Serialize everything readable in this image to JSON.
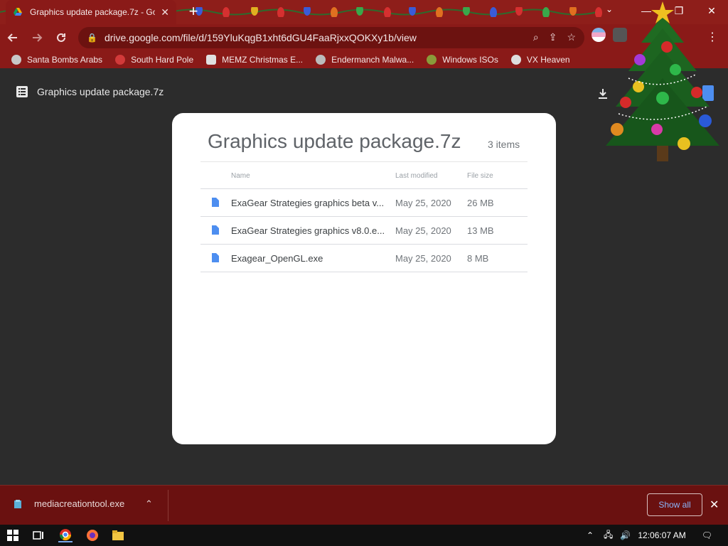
{
  "browser": {
    "tab_title": "Graphics update package.7z - Go",
    "tab_close": "✕",
    "new_tab": "+",
    "url": "drive.google.com/file/d/159YluKqgB1xht6dGU4FaaRjxxQOKXy1b/view",
    "window_controls": {
      "minimize": "—",
      "restore": "❐",
      "close": "✕"
    }
  },
  "bookmarks": [
    {
      "label": "Santa Bombs Arabs",
      "color": "#c8c8c8"
    },
    {
      "label": "South Hard Pole",
      "color": "#d23a3a"
    },
    {
      "label": "MEMZ Christmas E...",
      "color": "#e0e0e0"
    },
    {
      "label": "Endermanch Malwa...",
      "color": "#bbbbbb"
    },
    {
      "label": "Windows ISOs",
      "color": "#8a9b3a"
    },
    {
      "label": "VX Heaven",
      "color": "#dddddd"
    }
  ],
  "viewer": {
    "header_title": "Graphics update package.7z",
    "archive_title": "Graphics update package.7z",
    "item_count": "3 items",
    "columns": {
      "name": "Name",
      "modified": "Last modified",
      "size": "File size"
    },
    "files": [
      {
        "name": "ExaGear Strategies graphics beta v...",
        "modified": "May 25, 2020",
        "size": "26 MB"
      },
      {
        "name": "ExaGear Strategies graphics v8.0.e...",
        "modified": "May 25, 2020",
        "size": "13 MB"
      },
      {
        "name": "Exagear_OpenGL.exe",
        "modified": "May 25, 2020",
        "size": "8 MB"
      }
    ]
  },
  "downloads": {
    "file_name": "mediacreationtool.exe",
    "show_all": "Show all"
  },
  "taskbar": {
    "time": "12:06:07 AM"
  },
  "colors": {
    "chrome_red": "#8a1a18",
    "shelf_red": "#6a1110",
    "link_blue": "#8ab4f8",
    "file_blue": "#4d8ef0"
  }
}
